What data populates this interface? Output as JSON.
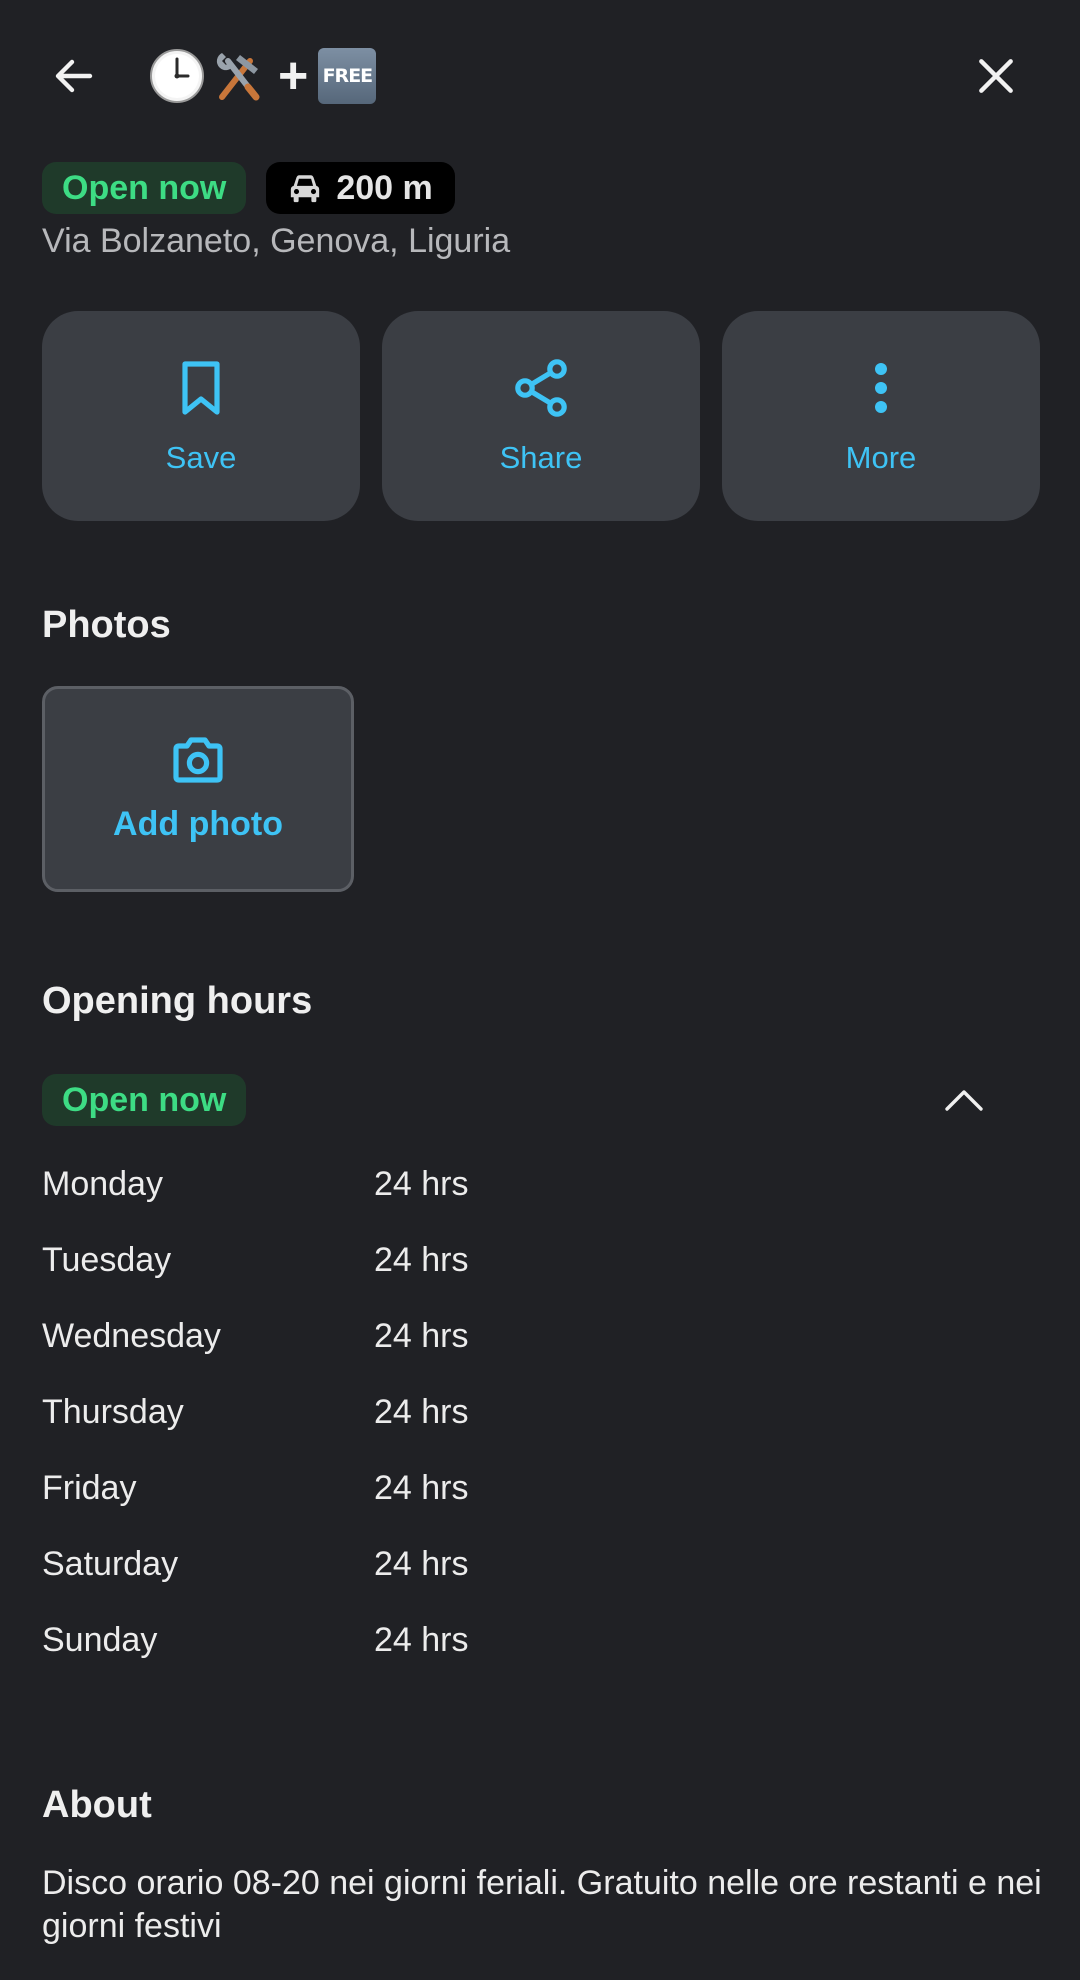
{
  "header": {
    "title_plus": "+",
    "free_badge": "FREE",
    "title_icons": [
      "clock-icon",
      "hammer-wrench-icon",
      "free-icon"
    ]
  },
  "status": {
    "open_label": "Open now",
    "distance": "200 m",
    "address": "Via Bolzaneto, Genova, Liguria"
  },
  "actions": [
    {
      "label": "Save",
      "icon": "bookmark-icon"
    },
    {
      "label": "Share",
      "icon": "share-icon"
    },
    {
      "label": "More",
      "icon": "more-vertical-icon"
    }
  ],
  "photos": {
    "title": "Photos",
    "add_label": "Add photo"
  },
  "opening_hours": {
    "title": "Opening hours",
    "status": "Open now",
    "days": [
      {
        "day": "Monday",
        "hours": "24 hrs"
      },
      {
        "day": "Tuesday",
        "hours": "24 hrs"
      },
      {
        "day": "Wednesday",
        "hours": "24 hrs"
      },
      {
        "day": "Thursday",
        "hours": "24 hrs"
      },
      {
        "day": "Friday",
        "hours": "24 hrs"
      },
      {
        "day": "Saturday",
        "hours": "24 hrs"
      },
      {
        "day": "Sunday",
        "hours": "24 hrs"
      }
    ]
  },
  "about": {
    "title": "About",
    "text": "Disco orario 08-20 nei giorni feriali. Gratuito nelle ore restanti e nei giorni festivi"
  },
  "colors": {
    "background": "#202125",
    "card": "#3b3e44",
    "accent": "#3ec3f5",
    "open_green": "#3ddc84"
  }
}
